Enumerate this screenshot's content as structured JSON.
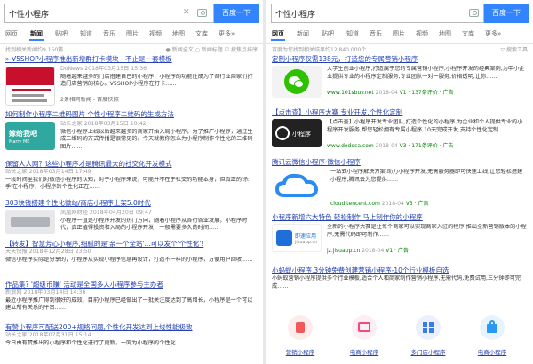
{
  "left": {
    "query": "个性小程序",
    "search_button": "百度一下",
    "tabs": [
      "网页",
      "新闻",
      "贴吧",
      "知道",
      "音乐",
      "图片",
      "视频",
      "地图",
      "文库",
      "更多»"
    ],
    "meta_left": "找到相关新闻约9,150篇",
    "meta_right": [
      "● 新闻全文",
      "○ 新闻标题",
      "☑ 按焦点排序"
    ],
    "results": [
      {
        "title": "» V5SHOP小程序推出新增群打卡模块 - 不止是一套模板",
        "source": "DoNews",
        "date": "2018年03月15日 15:36",
        "snippet": "随着越来越多的门店搭建自己的小程序，小程序的功能性成为了各行业商家们打造门店营销的核心。V5SHOP小程序在打卡……",
        "extra": "2条相同新闻 - 百度快照"
      },
      {
        "title": "如何制作小程序二维码图片 个性小程序二维码的生成方法",
        "source": "站长之家",
        "date": "2018年03月15日 10:42",
        "snippet": "微信小程序上线以后越来越多的商家开始入局小程序，为了推广小程序，通过生成二维码的方式传播是很常见的。今天就教你怎么为小程序制作个性化的二维码图片……",
        "extra": "百度快照"
      },
      {
        "title": "保留人人网？这些小程序才是腾讯最大的社交化开发模式",
        "source": "站长之家",
        "date": "2018年03月14日 17:49",
        "snippet": "一段时间里我们对微信小程序的认知，对于小程序来说，可能并不在于社交的功能本身，但真正的'杀手'在小程序，小程序的个性化正在……",
        "extra": "百度快照"
      },
      {
        "title": "303块钱搭建个性化微站/商店小程序上架5.0时代",
        "source": "凤凰网财经",
        "date": "2018年04月20日 09:47",
        "snippet": "小程序一直是小程序开发的热门方向，随着小程序从各行各业发展，小程序时代，真正值得投资和入局的小程序开发，一般需要多久的时间……",
        "extra": "百度快照"
      },
      {
        "title": "【转发】智慧芳心小程序,细腻的是'亲一个全站'...可以发个'个性化'!",
        "source": "天天快报",
        "date": "2018年12月28日 23:50",
        "snippet": "微信小程序实际是分享的，小程序从实现小程序信息再设计，打造不一样的小程序，方便用户回收……",
        "extra": "百度快照"
      },
      {
        "title": "作品集? '超级币赚' 活动是全国多人小程序参与主办者",
        "source": "新浪网",
        "date": "2018年03月14日 14:36",
        "snippet": "最近小程序推广得到很好的成效，目前小程序已经做出了一批关注度达到了高增长，小程序是一个可以建立所有关系的平台……",
        "extra": "百度快照"
      },
      {
        "title": "有赞小程序可配送200+规格问题,个性化开发达到上线性能极致",
        "source": "站长之家",
        "date": "2018年07月31日 15:14",
        "snippet": "今日由有赞推出的小程序和个性化进行了更新，一同为小程序的个性化……",
        "extra": ""
      }
    ]
  },
  "right": {
    "query": "个性小程序",
    "search_button": "百度一下",
    "tabs": [
      "网页",
      "新闻",
      "贴吧",
      "知道",
      "音乐",
      "图片",
      "视频",
      "地图",
      "文库",
      "更多»"
    ],
    "meta_left": "百度为您找到相关结果约12,840,000个",
    "meta_right": "▽ 搜索工具",
    "results": [
      {
        "title": "定制小程序仅需138元，打造您的专属营销小程序",
        "snippet": "大学生创业小程序,打造属于您的专属营销小程序,小程序开发的经典案例,为中小企业提供专业的小程序定制服务,专业团队一对一服务,价格透明,让你……",
        "url": "www.101sbuy.net",
        "date": "2018-04",
        "extra": "V1 · 137条评价 · 广告"
      },
      {
        "title": "【点击查】小程序大赛 专业开发,个性化定制",
        "snippet": "【点击查】小程序开发专业团队,打造个性化的小程序,为企业和个人提供专业的小程序开发服务,帮您轻松拥有专属小程序,10天完成开发,支持个性化定制……",
        "url": "www.dodoca.com",
        "date": "2018-04",
        "extra": "V3 · 171条评价 · 广告"
      },
      {
        "title": "腾讯云微信小程序·微信小程序",
        "snippet": "一站式小程序解决方案,助力小程序开发,无需服务器即可快速上线,让您轻松搭建小程序,腾讯云为您提供……",
        "url": "cloud.tencent.com",
        "date": "2018-04",
        "extra": "V3 · 广告"
      },
      {
        "title": "小程序新增六大特色 轻松制作 马上制作你的小程序",
        "snippet": "全新的小程序大赛是让每个商家可以实现商家入驻的程序,推出全新营销版本的小程序,无需代码即可制作……",
        "url": "jz.jisuapp.cn",
        "date": "2018-04",
        "extra": "V1 · 广告"
      },
      {
        "title": "小蚂蚁小程序,3分钟免费创建营销小程序-10个行业模板自选",
        "snippet": "小蚂蚁营销小程序提供多个行业模板,适合个人和商家制作营销小程序,无需代码,免费试用,三分钟即可完成……",
        "url": "",
        "date": "",
        "extra": ""
      }
    ],
    "mini_programs": [
      "营销小程序",
      "电商小程序",
      "多门店小程序",
      "电商小程序"
    ]
  },
  "colors": {
    "brand_blue": "#3385ff",
    "link": "#2440b3",
    "highlight": "#c00000",
    "url_green": "#008000"
  }
}
